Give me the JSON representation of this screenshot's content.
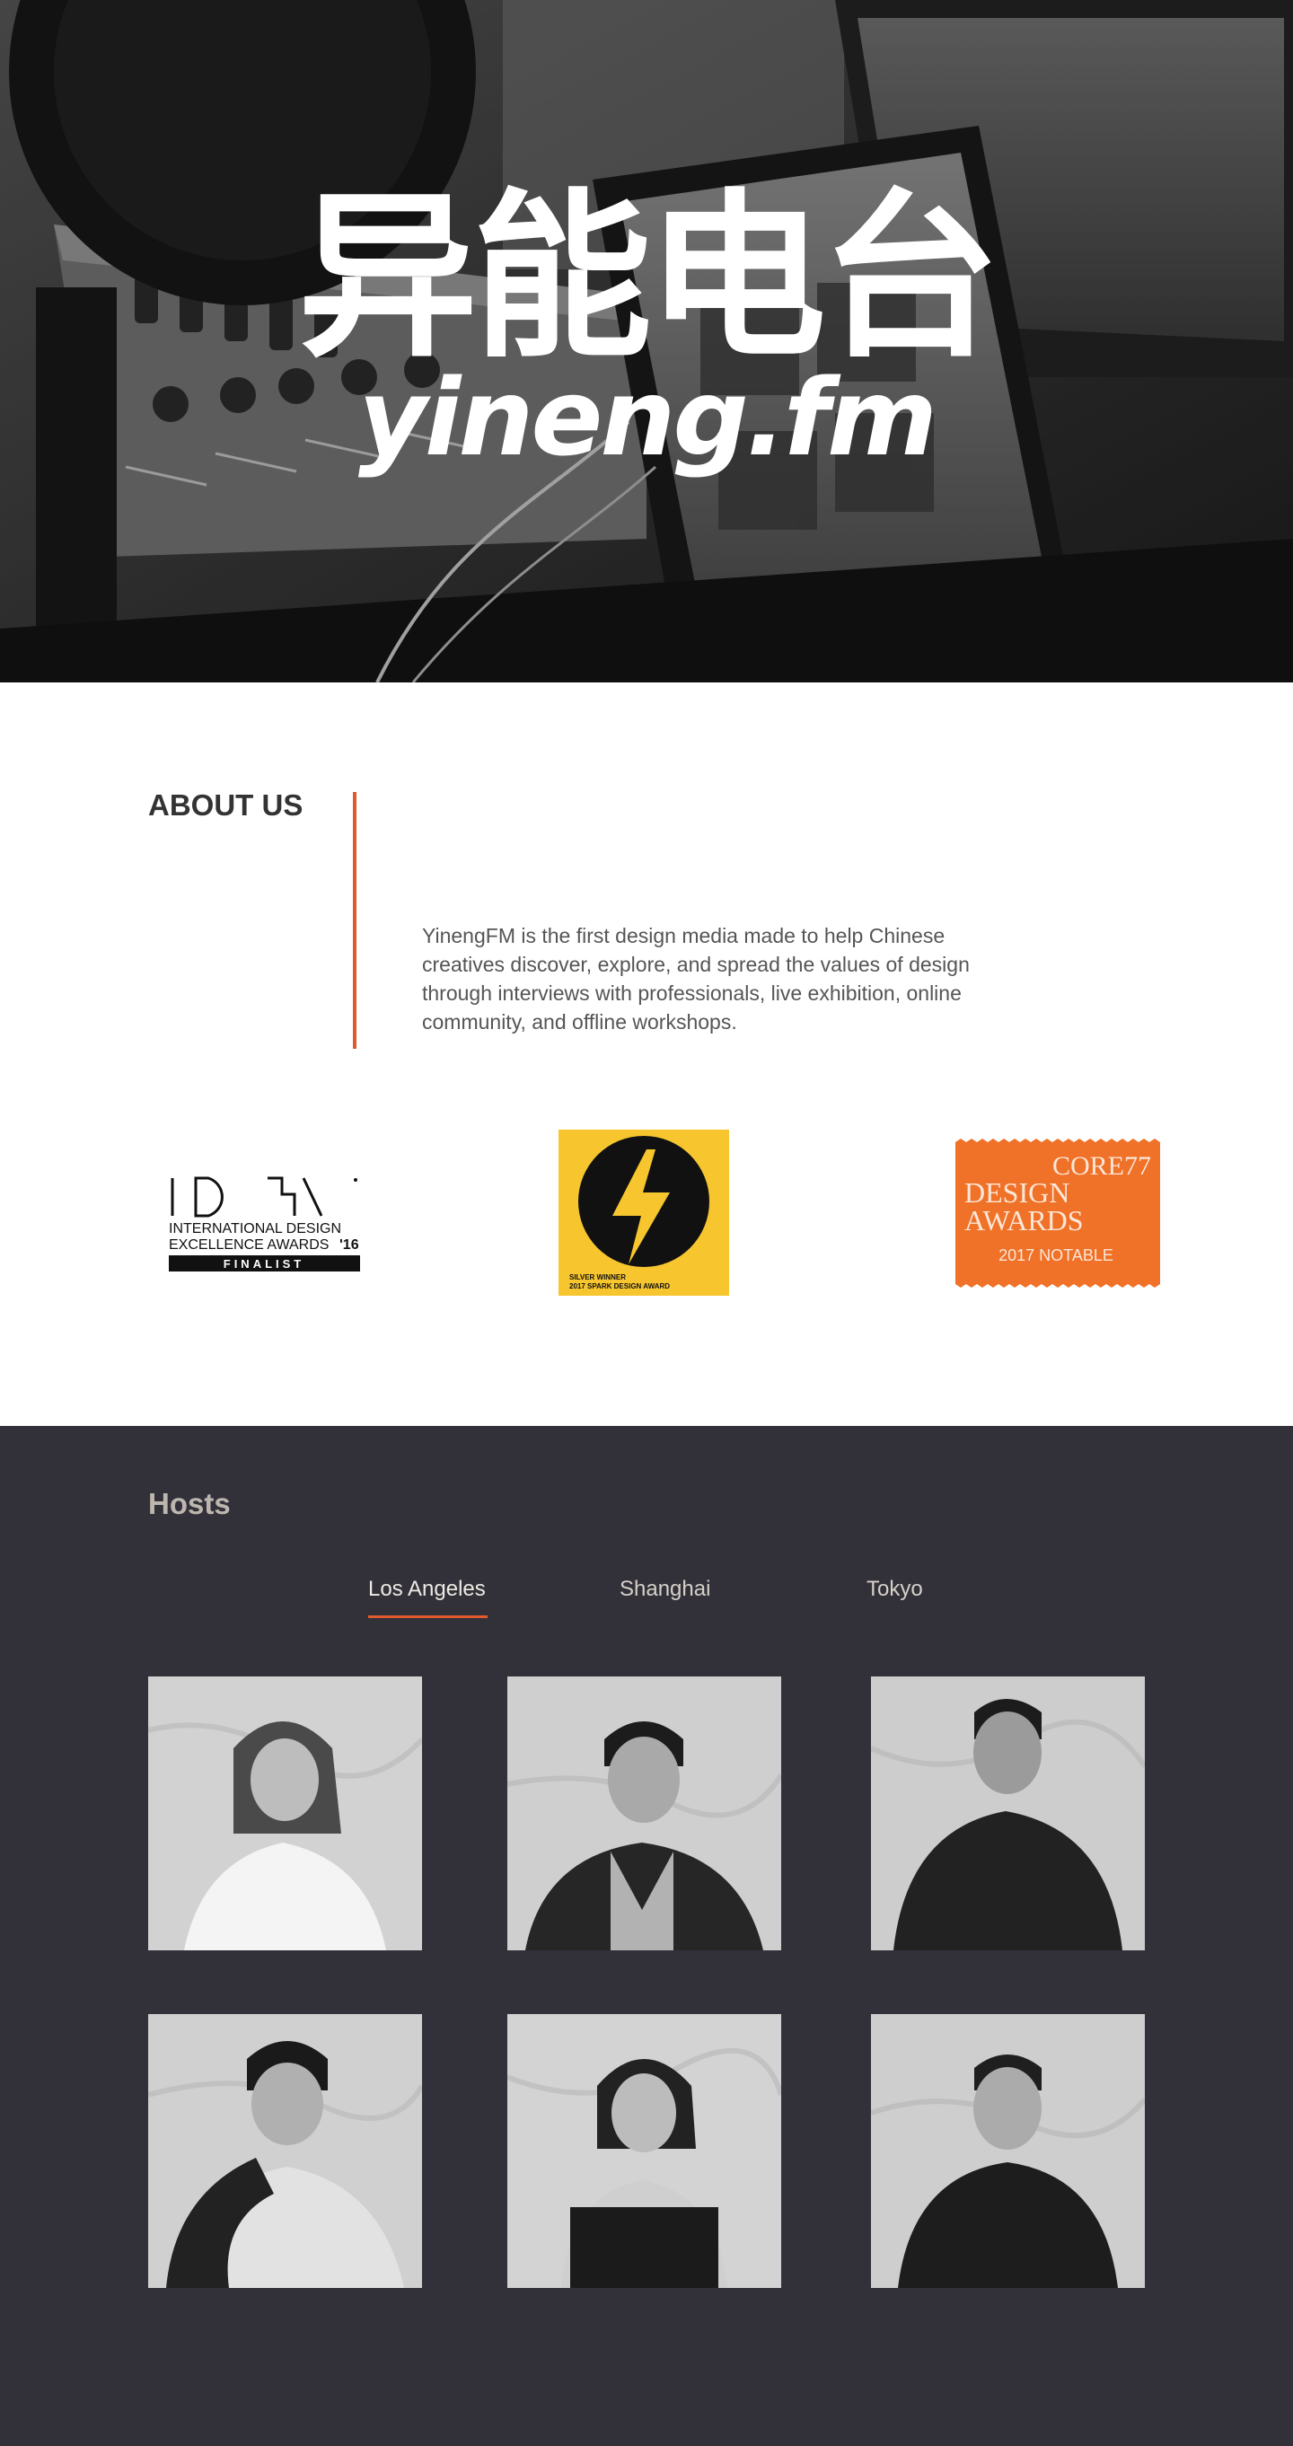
{
  "hero": {
    "title_cn": "异能电台",
    "title_en": "yineng.fm"
  },
  "about": {
    "heading": "ABOUT US",
    "text": "YinengFM is the first design media made to help Chinese creatives discover, explore, and spread the values of design through interviews with professionals, live exhibition, online community, and offline workshops.",
    "accent_color": "#e05a2b"
  },
  "awards": {
    "idea": {
      "line1": "INTERNATIONAL DESIGN",
      "line2": "EXCELLENCE AWARDS",
      "year": "'16",
      "badge": "FINALIST"
    },
    "spark": {
      "line1": "SILVER WINNER",
      "line2": "2017 SPARK DESIGN AWARD",
      "color": "#f7c62f"
    },
    "core77": {
      "line1": "CORE77",
      "line2": "DESIGN",
      "line3": "AWARDS",
      "line4": "2017 NOTABLE",
      "color": "#f07128"
    }
  },
  "hosts": {
    "heading": "Hosts",
    "tabs": [
      {
        "label": "Los Angeles",
        "active": true
      },
      {
        "label": "Shanghai",
        "active": false
      },
      {
        "label": "Tokyo",
        "active": false
      }
    ],
    "background": "#32313a"
  }
}
